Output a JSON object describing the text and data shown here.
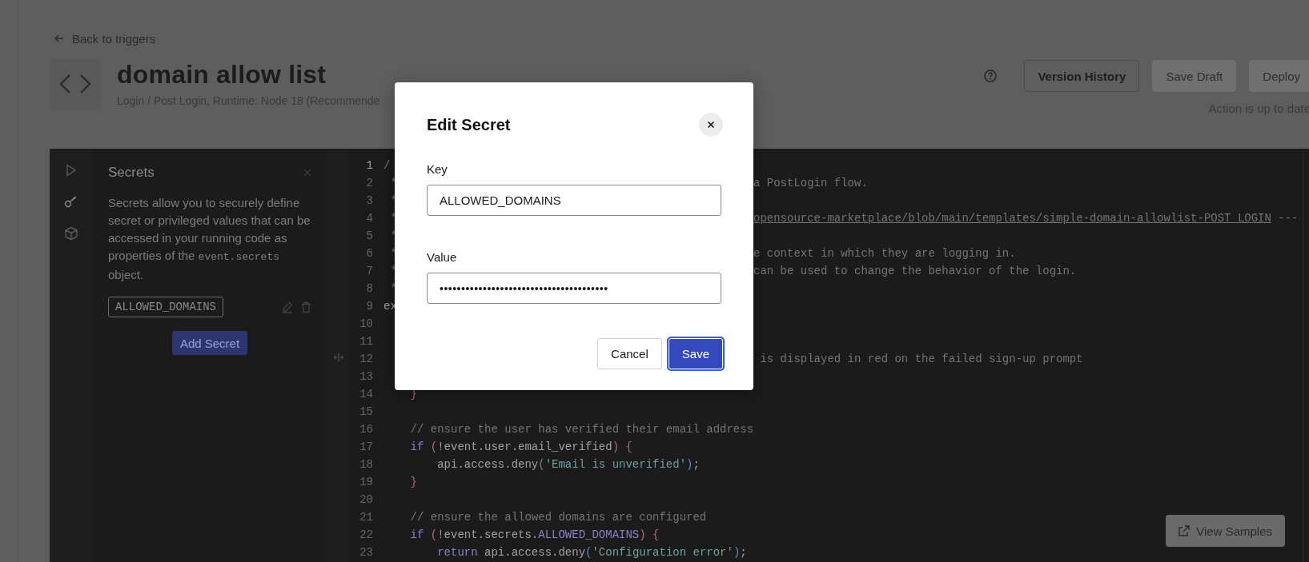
{
  "header": {
    "back_link": "Back to triggers",
    "title": "domain allow list",
    "subtitle": "Login / Post Login, Runtime: Node 18 (Recommende",
    "buttons": [
      {
        "label": "Version History",
        "disabled": false
      },
      {
        "label": "Save Draft",
        "disabled": true
      },
      {
        "label": "Deploy",
        "disabled": true
      }
    ],
    "status": "Action is up to date"
  },
  "sidebar_tabs": [
    {
      "kind": "run",
      "selected": false
    },
    {
      "kind": "secrets",
      "selected": true
    },
    {
      "kind": "dependencies",
      "selected": false
    }
  ],
  "secrets_panel": {
    "title": "Secrets",
    "description": {
      "before": "Secrets allow you to securely define secret or privileged values that can be accessed in your running code as properties of the ",
      "code": "event.secrets",
      "after": " object."
    },
    "secrets": [
      {
        "key": "ALLOWED_DOMAINS"
      }
    ],
    "add_button": "Add Secret"
  },
  "code_lines": [
    {
      "number": "1",
      "current": true,
      "left": [
        {
          "text": "/",
          "kind": "comment"
        }
      ]
    },
    {
      "number": "2",
      "current": false,
      "left": [
        {
          "text": " *",
          "kind": "comment"
        }
      ],
      "right": [
        {
          "text": "a PostLogin flow.",
          "kind": "comment"
        }
      ]
    },
    {
      "number": "3",
      "current": false,
      "left": [
        {
          "text": " *",
          "kind": "comment"
        }
      ]
    },
    {
      "number": "4",
      "current": false,
      "left": [
        {
          "text": " *",
          "kind": "comment"
        }
      ],
      "right": [
        {
          "text": "opensource-marketplace/blob/main/templates/simple-domain-allowlist-POST_LOGIN",
          "kind": "link"
        },
        {
          "text": " ---",
          "kind": "comment"
        }
      ]
    },
    {
      "number": "5",
      "current": false,
      "left": [
        {
          "text": " *",
          "kind": "comment"
        }
      ]
    },
    {
      "number": "6",
      "current": false,
      "left": [
        {
          "text": " *",
          "kind": "comment"
        }
      ],
      "right": [
        {
          "text": "e context in which they are logging in.",
          "kind": "comment"
        }
      ]
    },
    {
      "number": "7",
      "current": false,
      "left": [
        {
          "text": " *",
          "kind": "comment"
        }
      ],
      "right": [
        {
          "text": "can be used to change the behavior of the login.",
          "kind": "comment"
        }
      ]
    },
    {
      "number": "8",
      "current": false,
      "left": [
        {
          "text": " *",
          "kind": "comment"
        }
      ]
    },
    {
      "number": "9",
      "current": false,
      "left": [
        {
          "text": "ex",
          "kind": "plain"
        }
      ]
    },
    {
      "number": "10",
      "current": false
    },
    {
      "number": "11",
      "current": false
    },
    {
      "number": "12",
      "current": false,
      "right": [
        {
          "text": " is displayed in red on the failed sign-up prompt",
          "kind": "comment"
        }
      ]
    },
    {
      "number": "13",
      "current": false
    },
    {
      "number": "14",
      "current": false,
      "left": [
        {
          "text": "    }",
          "kind": "brace"
        }
      ]
    },
    {
      "number": "15",
      "current": false
    },
    {
      "number": "16",
      "current": false,
      "left": [
        {
          "text": "    // ensure the user has verified their email address",
          "kind": "comment"
        }
      ]
    },
    {
      "number": "17",
      "current": false,
      "left": [
        {
          "text": "    if ",
          "kind": "keyword"
        },
        {
          "text": "(",
          "kind": "brace"
        },
        {
          "text": "!event.user.email_verified",
          "kind": "plain"
        },
        {
          "text": ") {",
          "kind": "brace"
        }
      ]
    },
    {
      "number": "18",
      "current": false,
      "left": [
        {
          "text": "        api.access.deny",
          "kind": "plain"
        },
        {
          "text": "(",
          "kind": "paren"
        },
        {
          "text": "'Email is unverified'",
          "kind": "string"
        },
        {
          "text": ")",
          "kind": "paren"
        },
        {
          "text": ";",
          "kind": "plain"
        }
      ]
    },
    {
      "number": "19",
      "current": false,
      "left": [
        {
          "text": "    }",
          "kind": "brace"
        }
      ]
    },
    {
      "number": "20",
      "current": false
    },
    {
      "number": "21",
      "current": false,
      "left": [
        {
          "text": "    // ensure the allowed domains are configured",
          "kind": "comment"
        }
      ]
    },
    {
      "number": "22",
      "current": false,
      "left": [
        {
          "text": "    if ",
          "kind": "keyword"
        },
        {
          "text": "(",
          "kind": "brace"
        },
        {
          "text": "!event.secrets.",
          "kind": "plain"
        },
        {
          "text": "ALLOWED_DOMAINS",
          "kind": "keyword"
        },
        {
          "text": ") {",
          "kind": "brace"
        }
      ]
    },
    {
      "number": "23",
      "current": false,
      "left": [
        {
          "text": "        return ",
          "kind": "keyword"
        },
        {
          "text": "api.access.deny",
          "kind": "plain"
        },
        {
          "text": "(",
          "kind": "paren"
        },
        {
          "text": "'Configuration error'",
          "kind": "string"
        },
        {
          "text": ")",
          "kind": "paren"
        },
        {
          "text": ";",
          "kind": "plain"
        }
      ]
    }
  ],
  "view_samples_button": "View Samples",
  "dialog": {
    "title": "Edit Secret",
    "fields": [
      {
        "label": "Key",
        "value": "ALLOWED_DOMAINS",
        "kind": "text"
      },
      {
        "label": "Value",
        "value": "•••••••••••••••••••••••••••••••••••••••",
        "kind": "password"
      }
    ],
    "buttons": [
      {
        "label": "Cancel",
        "kind": "secondary"
      },
      {
        "label": "Save",
        "kind": "primary"
      }
    ]
  }
}
